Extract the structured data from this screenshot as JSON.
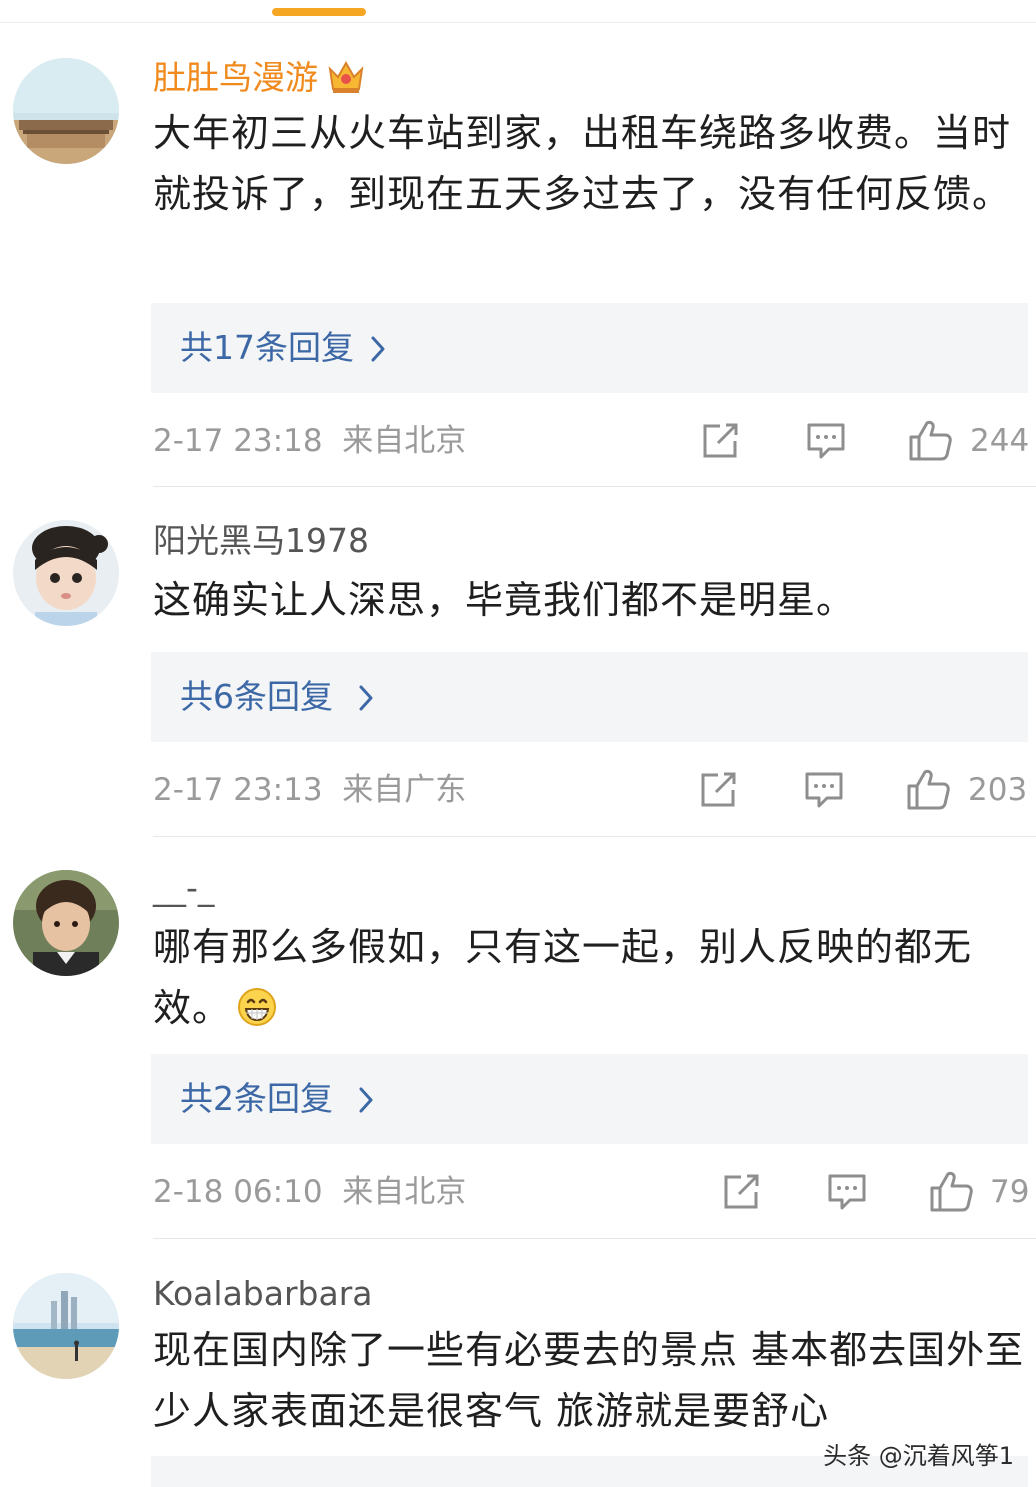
{
  "comments": [
    {
      "username": "肚肚鸟漫游",
      "text": "大年初三从火车站到家，出租车绕路多收费。当时就投诉了，到现在五天多过去了，没有任何反馈。",
      "replies": "共17条回复",
      "time": "2-17 23:18",
      "location": "来自北京",
      "likes": "244",
      "badge": "crown-icon"
    },
    {
      "username": "阳光黑马1978",
      "text": "这确实让人深思，毕竟我们都不是明星。",
      "replies": "共6条回复",
      "time": "2-17 23:13",
      "location": "来自广东",
      "likes": "203"
    },
    {
      "username": "__-_",
      "text": "哪有那么多假如，只有这一起，别人反映的都无效。",
      "emoji": "grin-emoji",
      "replies": "共2条回复",
      "time": "2-18 06:10",
      "location": "来自北京",
      "likes": "79"
    },
    {
      "username": "Koalabarbara",
      "text": "现在国内除了一些有必要去的景点 基本都去国外至少人家表面还是很客气 旅游就是要舒心"
    }
  ],
  "watermark": "头条 @沉着风筝1",
  "colors": {
    "accent": "#f5a623",
    "vip_name": "#f08a1c",
    "reply_link": "#3d68a6",
    "meta": "#9a9a9a"
  }
}
